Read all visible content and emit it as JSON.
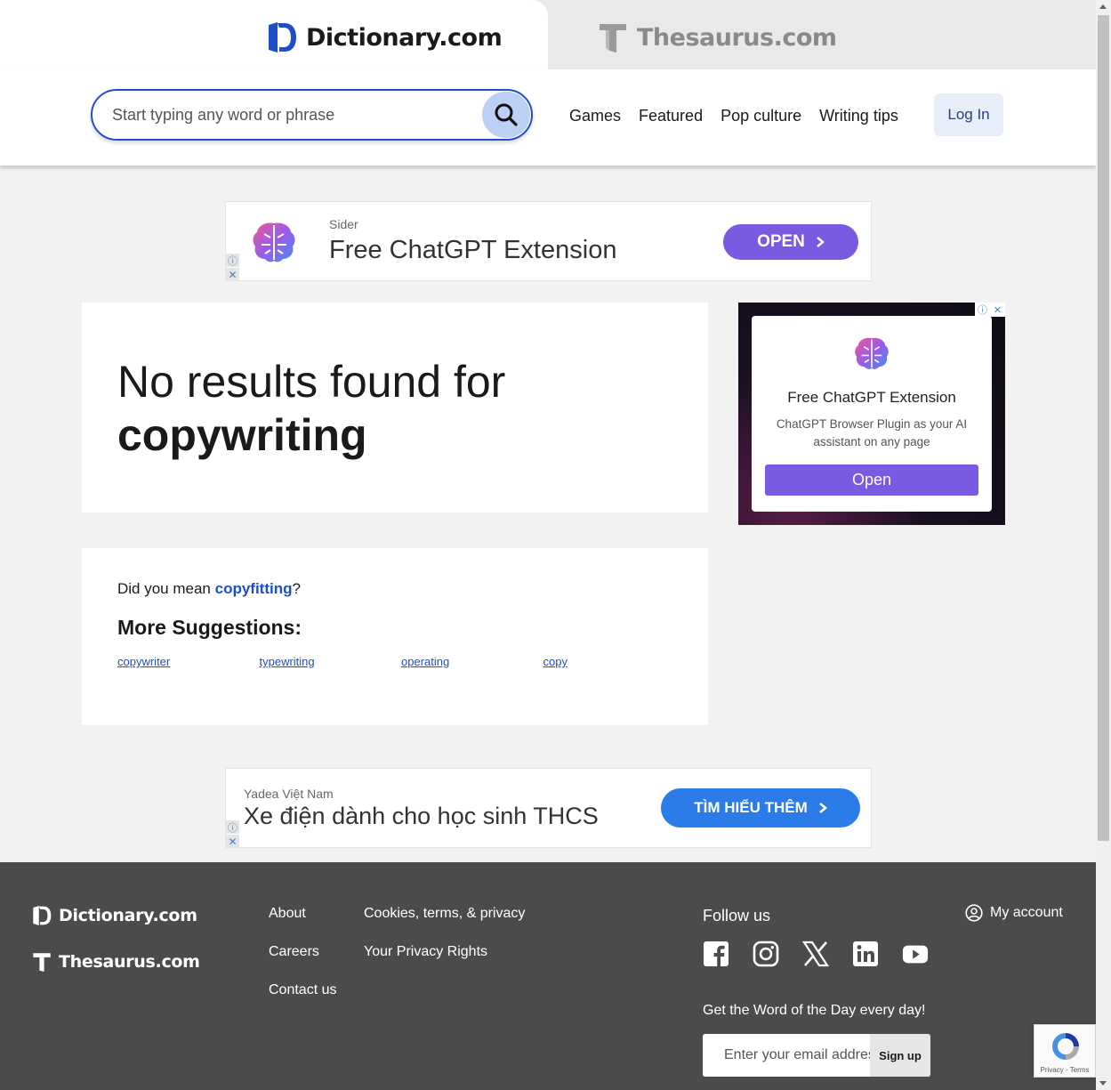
{
  "header": {
    "dictionary_logo": "Dictionary.com",
    "thesaurus_logo": "Thesaurus.com"
  },
  "search": {
    "placeholder": "Start typing any word or phrase",
    "value": ""
  },
  "nav": {
    "links": [
      "Games",
      "Featured",
      "Pop culture",
      "Writing tips"
    ],
    "login": "Log In"
  },
  "ad_top": {
    "sponsor": "Sider",
    "headline": "Free ChatGPT Extension",
    "cta": "OPEN"
  },
  "results": {
    "line1": "No results found for",
    "query": "copywriting"
  },
  "suggestions": {
    "did_you_mean_prefix": "Did you mean ",
    "did_you_mean_word": "copyfitting",
    "did_you_mean_suffix": "?",
    "more_heading": "More Suggestions:",
    "items": [
      "copywriter",
      "typewriting",
      "operating",
      "copy"
    ]
  },
  "side_ad": {
    "title": "Free ChatGPT Extension",
    "description": "ChatGPT Browser Plugin as your AI assistant on any page",
    "cta": "Open"
  },
  "ad_bottom": {
    "sponsor": "Yadea Việt Nam",
    "headline": "Xe điện dành cho học sinh THCS",
    "cta": "TÌM HIỂU THÊM"
  },
  "footer": {
    "dictionary_logo": "Dictionary.com",
    "thesaurus_logo": "Thesaurus.com",
    "col1": [
      "About",
      "Careers",
      "Contact us"
    ],
    "col2": [
      "Cookies, terms, & privacy",
      "Your Privacy Rights"
    ],
    "follow_us": "Follow us",
    "socials": [
      "facebook-icon",
      "instagram-icon",
      "x-icon",
      "linkedin-icon",
      "youtube-icon"
    ],
    "wotd_text": "Get the Word of the Day every day!",
    "email_placeholder": "Enter your email address",
    "signup": "Sign up",
    "my_account": "My account"
  },
  "recaptcha": {
    "label": "Privacy - Terms"
  },
  "colors": {
    "brand_blue": "#1f4ec9",
    "ad_purple": "#7a5ae0",
    "ad_blue": "#2b7be8",
    "footer_bg": "#4b4b4b"
  }
}
